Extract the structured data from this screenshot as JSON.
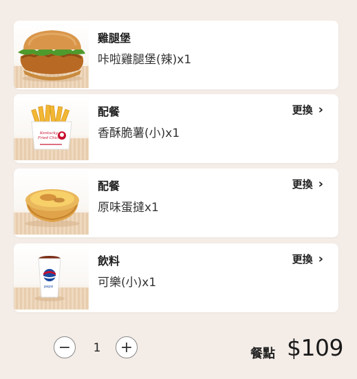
{
  "items": [
    {
      "category": "雞腿堡",
      "description": "咔啦雞腿堡(辣)x1",
      "image": "chicken-burger",
      "swap_label": ""
    },
    {
      "category": "配餐",
      "description": "香酥脆薯(小)x1",
      "image": "french-fries",
      "swap_label": "更換"
    },
    {
      "category": "配餐",
      "description": "原味蛋撻x1",
      "image": "egg-tart",
      "swap_label": "更換"
    },
    {
      "category": "飲料",
      "description": "可樂(小)x1",
      "image": "cola-cup",
      "swap_label": "更換"
    }
  ],
  "footer": {
    "minus_label": "−",
    "quantity": "1",
    "plus_label": "+",
    "price_label": "餐點",
    "price": "$109"
  },
  "colors": {
    "background": "#f3ece7",
    "card": "#ffffff",
    "kfc_red": "#c8102e",
    "pepsi_blue": "#1b4aa0"
  }
}
